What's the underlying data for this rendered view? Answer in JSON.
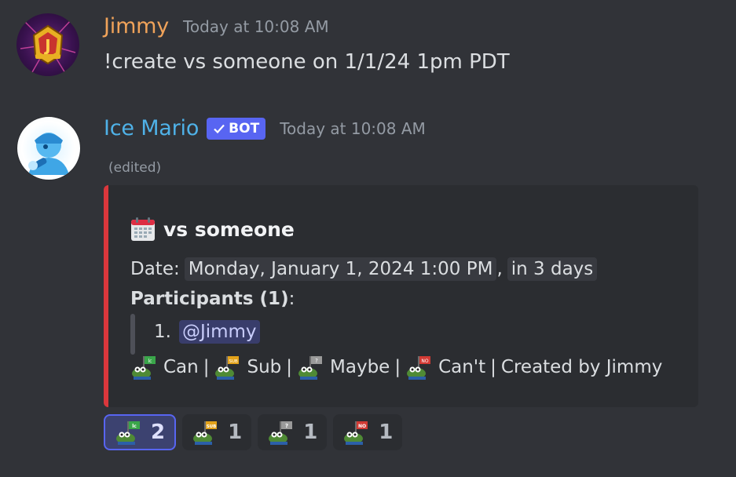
{
  "messages": [
    {
      "author": "Jimmy",
      "timestamp": "Today at 10:08 AM",
      "text": "!create vs someone on 1/1/24 1pm PDT"
    },
    {
      "author": "Ice Mario",
      "bot_tag": "BOT",
      "timestamp": "Today at 10:08 AM",
      "edited": "(edited)",
      "embed": {
        "accent_color": "#da373c",
        "title_icon": "calendar-icon",
        "title": "vs someone",
        "date_label": "Date:",
        "date_value": "Monday, January 1, 2024 1:00 PM",
        "date_sep": ",",
        "relative": "in 3 days",
        "participants_label": "Participants (1)",
        "participants_colon": ":",
        "participants": [
          {
            "index": "1.",
            "mention": "@Jimmy"
          }
        ],
        "legend": [
          {
            "icon": "pepe-can-icon",
            "label": "Can"
          },
          {
            "icon": "pepe-sub-icon",
            "label": "Sub"
          },
          {
            "icon": "pepe-maybe-icon",
            "label": "Maybe"
          },
          {
            "icon": "pepe-no-icon",
            "label": "Can't"
          }
        ],
        "separator": "|",
        "created_by": "Created by Jimmy"
      },
      "reactions": [
        {
          "icon": "pepe-can-icon",
          "count": "2",
          "active": true
        },
        {
          "icon": "pepe-sub-icon",
          "count": "1",
          "active": false
        },
        {
          "icon": "pepe-maybe-icon",
          "count": "1",
          "active": false
        },
        {
          "icon": "pepe-no-icon",
          "count": "1",
          "active": false
        }
      ]
    }
  ],
  "colors": {
    "background": "#313338",
    "jimmy_name": "#f0a35a",
    "bot_name": "#4fb2e8",
    "bot_tag": "#5865f2"
  }
}
